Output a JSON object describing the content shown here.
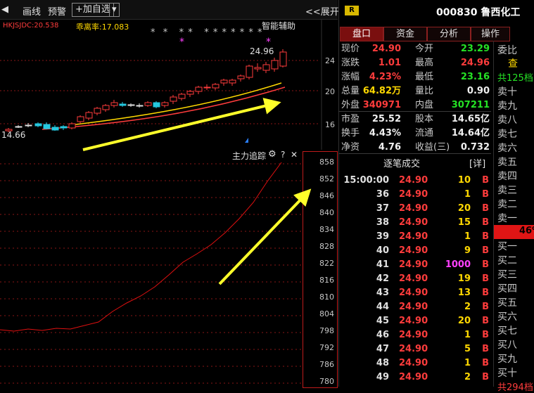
{
  "toolbar": {
    "back": "◀",
    "draw": "画线",
    "alert": "预警",
    "add_watch": "+加自选",
    "dropdown": "▾",
    "expand": "<<展开"
  },
  "top_chart": {
    "indicator": "HKJSJDC:20.538",
    "deviation": "乖离率:17.083",
    "assist": "智能辅助",
    "high_label": "24.96",
    "low_label": "14.66",
    "stars_a": "*  *   * *   * * * * * * *",
    "y_ticks": [
      "24",
      "20",
      "16"
    ]
  },
  "bottom_chart": {
    "title": "主力追踪",
    "settings_icon": "⚙",
    "help": "?",
    "close": "✕",
    "y_ticks": [
      "858",
      "852",
      "846",
      "840",
      "834",
      "828",
      "822",
      "816",
      "810",
      "804",
      "798",
      "792",
      "786",
      "780"
    ]
  },
  "header": {
    "badge": "R",
    "title": "000830 鲁西化工",
    "tabs": [
      "盘口",
      "资金",
      "分析",
      "操作"
    ]
  },
  "quote": [
    {
      "l": "现价",
      "v": "24.90",
      "vc": "red",
      "l2": "今开",
      "v2": "23.29",
      "v2c": "green"
    },
    {
      "l": "涨跌",
      "v": "1.01",
      "vc": "red",
      "l2": "最高",
      "v2": "24.96",
      "v2c": "red"
    },
    {
      "l": "涨幅",
      "v": "4.23%",
      "vc": "red",
      "l2": "最低",
      "v2": "23.16",
      "v2c": "green"
    },
    {
      "l": "总量",
      "v": "64.82万",
      "vc": "yellow",
      "l2": "量比",
      "v2": "0.90",
      "v2c": "white"
    },
    {
      "l": "外盘",
      "v": "340971",
      "vc": "red",
      "l2": "内盘",
      "v2": "307211",
      "v2c": "green"
    },
    {
      "l": "市盈",
      "v": "25.52",
      "vc": "white",
      "l2": "股本",
      "v2": "14.65亿",
      "v2c": "white"
    },
    {
      "l": "换手",
      "v": "4.43%",
      "vc": "white",
      "l2": "流通",
      "v2": "14.64亿",
      "v2c": "white"
    },
    {
      "l": "净资",
      "v": "4.76",
      "vc": "white",
      "l2": "收益(三)",
      "v2": "0.732",
      "v2c": "white"
    }
  ],
  "ticks": {
    "title": "逐笔成交",
    "detail": "[详]",
    "rows": [
      {
        "time": "15:00:00",
        "price": "24.90",
        "vol": "10",
        "vc": "yellow",
        "bs": "B"
      },
      {
        "time": "36",
        "price": "24.90",
        "vol": "1",
        "vc": "yellow",
        "bs": "B"
      },
      {
        "time": "37",
        "price": "24.90",
        "vol": "20",
        "vc": "yellow",
        "bs": "B"
      },
      {
        "time": "38",
        "price": "24.90",
        "vol": "15",
        "vc": "yellow",
        "bs": "B"
      },
      {
        "time": "39",
        "price": "24.90",
        "vol": "1",
        "vc": "yellow",
        "bs": "B"
      },
      {
        "time": "40",
        "price": "24.90",
        "vol": "9",
        "vc": "yellow",
        "bs": "B"
      },
      {
        "time": "41",
        "price": "24.90",
        "vol": "1000",
        "vc": "magenta",
        "bs": "B"
      },
      {
        "time": "42",
        "price": "24.90",
        "vol": "19",
        "vc": "yellow",
        "bs": "B"
      },
      {
        "time": "43",
        "price": "24.90",
        "vol": "13",
        "vc": "yellow",
        "bs": "B"
      },
      {
        "time": "44",
        "price": "24.90",
        "vol": "2",
        "vc": "yellow",
        "bs": "B"
      },
      {
        "time": "45",
        "price": "24.90",
        "vol": "20",
        "vc": "yellow",
        "bs": "B"
      },
      {
        "time": "46",
        "price": "24.90",
        "vol": "1",
        "vc": "yellow",
        "bs": "B"
      },
      {
        "time": "47",
        "price": "24.90",
        "vol": "5",
        "vc": "yellow",
        "bs": "B"
      },
      {
        "time": "48",
        "price": "24.90",
        "vol": "1",
        "vc": "yellow",
        "bs": "B"
      },
      {
        "time": "49",
        "price": "24.90",
        "vol": "2",
        "vc": "yellow",
        "bs": "B"
      }
    ]
  },
  "book": {
    "header": "委比",
    "sub": "查",
    "sell_total": "共125档",
    "sell": [
      "卖十",
      "卖九",
      "卖八",
      "卖七",
      "卖六",
      "卖五",
      "卖四",
      "卖三",
      "卖二",
      "卖一"
    ],
    "ratio": "46%",
    "buy": [
      "买一",
      "买二",
      "买三",
      "买四",
      "买五",
      "买六",
      "买七",
      "买八",
      "买九",
      "买十"
    ],
    "buy_total": "共294档"
  },
  "colors": {
    "up": "#ff3c3c",
    "down": "#25e225",
    "accent": "#ffd800"
  }
}
